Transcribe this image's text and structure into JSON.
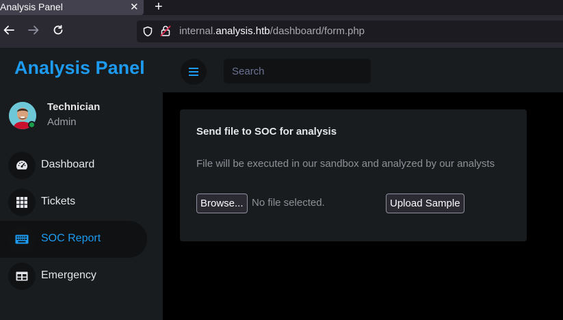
{
  "browser": {
    "tab_title": "Analysis Panel",
    "tab_close": "✕",
    "new_tab": "+",
    "url_prefix": "internal.",
    "url_host": "analysis.htb",
    "url_path": "/dashboard/form.php"
  },
  "sidebar": {
    "brand": "Analysis Panel",
    "user": {
      "name": "Technician",
      "role": "Admin"
    },
    "items": [
      {
        "label": "Dashboard",
        "icon": "speedometer-icon",
        "active": false
      },
      {
        "label": "Tickets",
        "icon": "grid-icon",
        "active": false
      },
      {
        "label": "SOC Report",
        "icon": "keyboard-icon",
        "active": true
      },
      {
        "label": "Emergency",
        "icon": "table-icon",
        "active": false
      }
    ]
  },
  "topbar": {
    "search_placeholder": "Search"
  },
  "form": {
    "title": "Send file to SOC for analysis",
    "description": "File will be executed in our sandbox and analyzed by our analysts",
    "browse_label": "Browse...",
    "file_status": "No file selected.",
    "upload_label": "Upload Sample"
  },
  "colors": {
    "accent": "#1d9bf0",
    "background": "#191c1f",
    "content_bg": "#000000",
    "status_online": "#1a9e4c"
  }
}
